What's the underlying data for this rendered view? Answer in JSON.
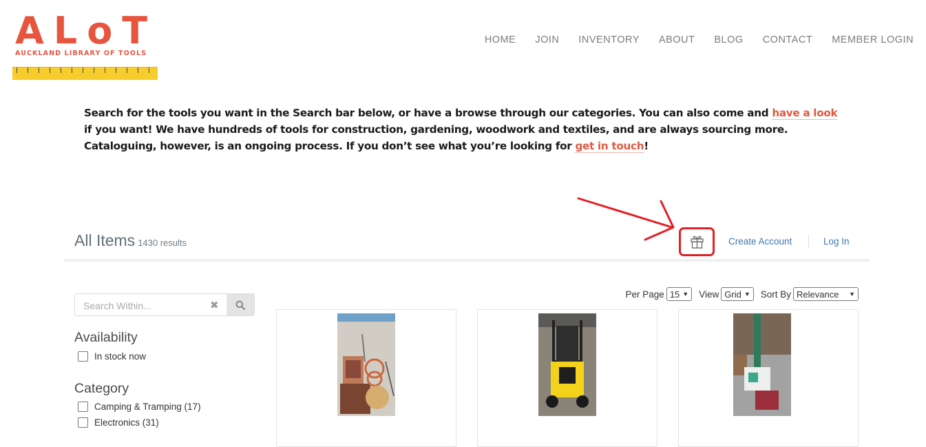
{
  "logo": {
    "title": "ALoT",
    "subtitle": "AUCKLAND LIBRARY OF TOOLS"
  },
  "nav": [
    "HOME",
    "JOIN",
    "INVENTORY",
    "ABOUT",
    "BLOG",
    "CONTACT",
    "MEMBER LOGIN"
  ],
  "intro": {
    "part1": "Search for the tools you want in the Search bar below, or have a browse through our categories. You can also come and ",
    "link1": "have a look",
    "part2": " if you want!  We have hundreds of tools for construction, gardening, woodwork and textiles, and are always sourcing more. Cataloguing, however, is an ongoing process. If you don’t see what you’re looking for ",
    "link2": "get in touch",
    "part3": "!"
  },
  "items": {
    "title": "All Items",
    "count": "1430 results"
  },
  "account": {
    "create": "Create Account",
    "login": "Log In"
  },
  "search": {
    "placeholder": "Search Within..."
  },
  "availability": {
    "heading": "Availability",
    "option": "In stock now"
  },
  "category": {
    "heading": "Category",
    "options": [
      "Camping & Tramping (17)",
      "Electronics (31)"
    ]
  },
  "controls": {
    "per_page_label": "Per Page",
    "per_page": "15",
    "view_label": "View",
    "view": "Grid",
    "sort_label": "Sort By",
    "sort": "Relevance"
  },
  "colors": {
    "brand": "#e8553f",
    "ruler": "#f6cd2c",
    "link": "#3b77b0",
    "annotation": "#e31e24"
  },
  "icons": {
    "gift": "gift-icon",
    "search": "search-icon",
    "clear": "close-icon"
  },
  "cards": [
    {
      "image": "craft-tools-photo"
    },
    {
      "image": "lawn-mower-photo"
    },
    {
      "image": "vacuum-cleaner-photo"
    }
  ]
}
